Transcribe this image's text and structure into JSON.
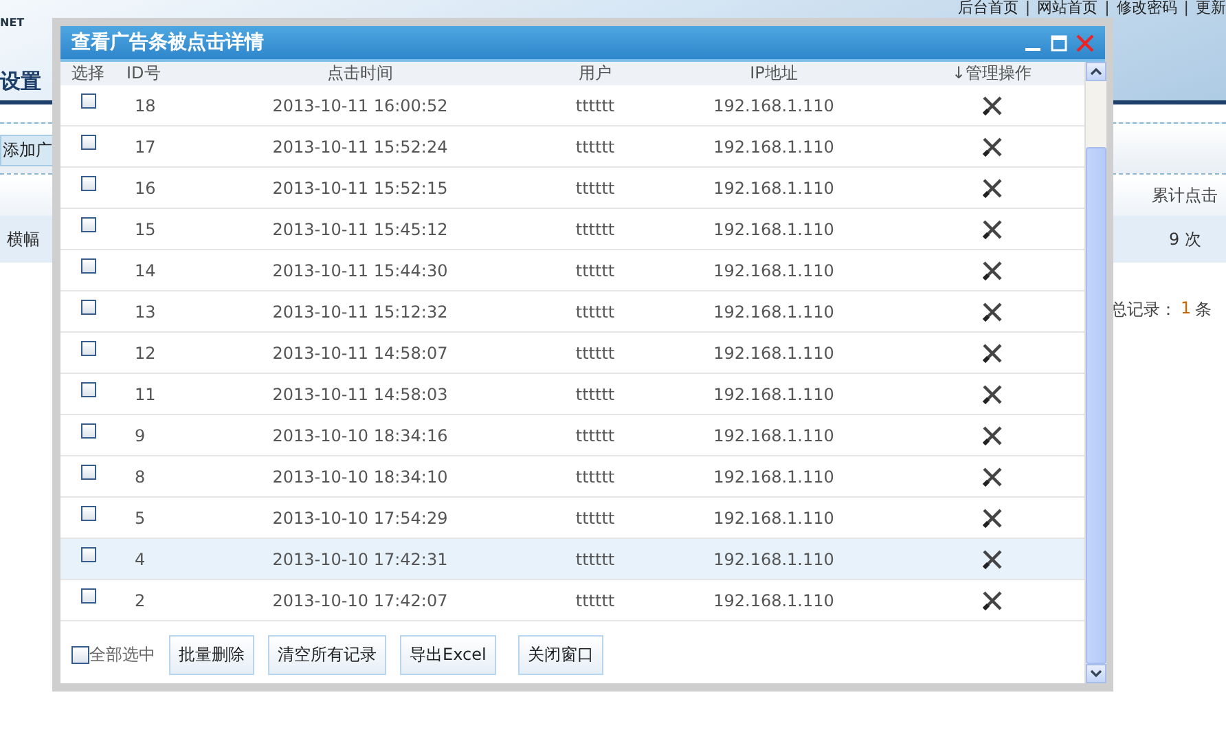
{
  "background_page": {
    "logo_text": "NET",
    "top_links": [
      {
        "kind": "link",
        "text": "后台首页"
      },
      {
        "kind": "separator",
        "text": "|"
      },
      {
        "kind": "link",
        "text": "网站首页"
      },
      {
        "kind": "separator",
        "text": "|"
      },
      {
        "kind": "link",
        "text": "修改密码"
      },
      {
        "kind": "separator",
        "text": "|"
      },
      {
        "kind": "link",
        "text": "更新"
      }
    ],
    "section_title": "设置",
    "add_button": "添加广",
    "table_header": "累计点击",
    "row_label": "横幅",
    "click_count": "9 次",
    "pagination": {
      "label": "总记录：",
      "count": "1",
      "unit": "条"
    }
  },
  "dialog": {
    "title": "查看广告条被点击详情",
    "columns": [
      "选择",
      "ID号",
      "点击时间",
      "用户",
      "IP地址",
      "↓管理操作"
    ],
    "rows": [
      {
        "id": "18",
        "time": "2013-10-11 16:00:52",
        "user": "tttttt",
        "ip": "192.168.1.110",
        "checked": false,
        "highlighted": false
      },
      {
        "id": "17",
        "time": "2013-10-11 15:52:24",
        "user": "tttttt",
        "ip": "192.168.1.110",
        "checked": false,
        "highlighted": false
      },
      {
        "id": "16",
        "time": "2013-10-11 15:52:15",
        "user": "tttttt",
        "ip": "192.168.1.110",
        "checked": false,
        "highlighted": false
      },
      {
        "id": "15",
        "time": "2013-10-11 15:45:12",
        "user": "tttttt",
        "ip": "192.168.1.110",
        "checked": false,
        "highlighted": false
      },
      {
        "id": "14",
        "time": "2013-10-11 15:44:30",
        "user": "tttttt",
        "ip": "192.168.1.110",
        "checked": false,
        "highlighted": false
      },
      {
        "id": "13",
        "time": "2013-10-11 15:12:32",
        "user": "tttttt",
        "ip": "192.168.1.110",
        "checked": false,
        "highlighted": false
      },
      {
        "id": "12",
        "time": "2013-10-11 14:58:07",
        "user": "tttttt",
        "ip": "192.168.1.110",
        "checked": false,
        "highlighted": false
      },
      {
        "id": "11",
        "time": "2013-10-11 14:58:03",
        "user": "tttttt",
        "ip": "192.168.1.110",
        "checked": false,
        "highlighted": false
      },
      {
        "id": "9",
        "time": "2013-10-10 18:34:16",
        "user": "tttttt",
        "ip": "192.168.1.110",
        "checked": false,
        "highlighted": false
      },
      {
        "id": "8",
        "time": "2013-10-10 18:34:10",
        "user": "tttttt",
        "ip": "192.168.1.110",
        "checked": false,
        "highlighted": false
      },
      {
        "id": "5",
        "time": "2013-10-10 17:54:29",
        "user": "tttttt",
        "ip": "192.168.1.110",
        "checked": false,
        "highlighted": false
      },
      {
        "id": "4",
        "time": "2013-10-10 17:42:31",
        "user": "tttttt",
        "ip": "192.168.1.110",
        "checked": false,
        "highlighted": true
      },
      {
        "id": "2",
        "time": "2013-10-10 17:42:07",
        "user": "tttttt",
        "ip": "192.168.1.110",
        "checked": false,
        "highlighted": false
      }
    ],
    "select_all": {
      "label": "全部选中",
      "checked": false
    },
    "buttons": [
      "批量删除",
      "清空所有记录",
      "导出Excel",
      "关闭窗口"
    ]
  }
}
